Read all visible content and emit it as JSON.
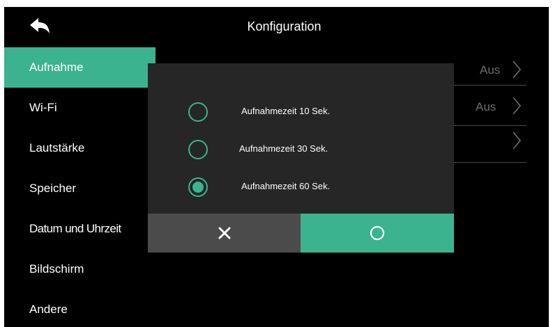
{
  "header": {
    "title": "Konfiguration",
    "back_icon": "back-arrow-icon"
  },
  "sidebar": {
    "items": [
      {
        "label": "Aufnahme",
        "active": true
      },
      {
        "label": "Wi-Fi",
        "active": false
      },
      {
        "label": "Lautstärke",
        "active": false
      },
      {
        "label": "Speicher",
        "active": false
      },
      {
        "label": "Datum und Uhrzeit",
        "active": false
      },
      {
        "label": "Bildschirm",
        "active": false
      },
      {
        "label": "Andere",
        "active": false
      }
    ]
  },
  "settings_rows": [
    {
      "value": "Aus",
      "icon": "chevron-right-icon"
    },
    {
      "value": "Aus",
      "icon": "chevron-right-icon"
    },
    {
      "value": "",
      "icon": "chevron-right-icon"
    }
  ],
  "dialog": {
    "options": [
      {
        "label": "Aufnahmezeit 10 Sek.",
        "selected": false
      },
      {
        "label": "Aufnahmezeit 30 Sek.",
        "selected": false
      },
      {
        "label": "Aufnahmezeit 60 Sek.",
        "selected": true
      }
    ],
    "cancel_icon": "close-icon",
    "confirm_icon": "circle-confirm-icon"
  },
  "colors": {
    "accent": "#3bb38f",
    "background": "#000000",
    "dialog": "#262626",
    "cancel_button": "#4b4b4b",
    "muted_text": "#6e6e6e"
  }
}
